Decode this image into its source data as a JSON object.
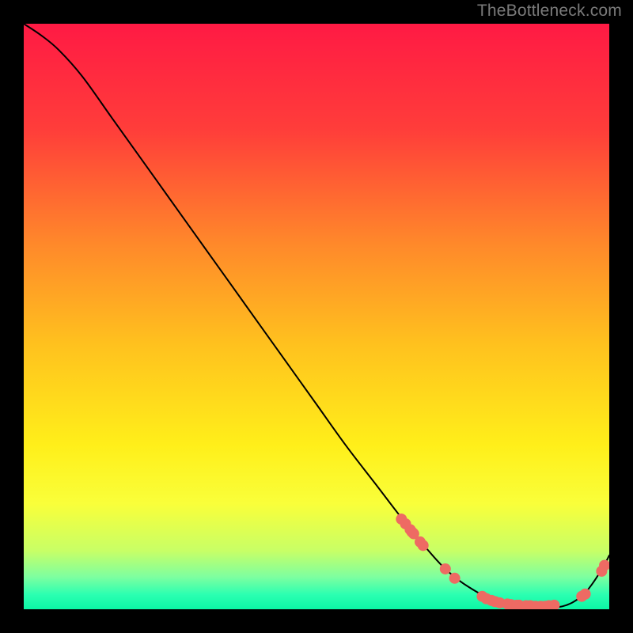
{
  "attribution": "TheBottleneck.com",
  "chart_data": {
    "type": "line",
    "title": "",
    "xlabel": "",
    "ylabel": "",
    "xlim": [
      0,
      100
    ],
    "ylim": [
      0,
      100
    ],
    "grid": false,
    "axes_visible": false,
    "background_gradient": {
      "stops": [
        {
          "offset": 0.0,
          "color": "#ff1a44"
        },
        {
          "offset": 0.18,
          "color": "#ff3d3a"
        },
        {
          "offset": 0.38,
          "color": "#ff8a2a"
        },
        {
          "offset": 0.55,
          "color": "#ffc21e"
        },
        {
          "offset": 0.72,
          "color": "#ffef1a"
        },
        {
          "offset": 0.82,
          "color": "#f9ff3a"
        },
        {
          "offset": 0.9,
          "color": "#c8ff66"
        },
        {
          "offset": 0.945,
          "color": "#7dffa0"
        },
        {
          "offset": 0.975,
          "color": "#2bffb1"
        },
        {
          "offset": 1.0,
          "color": "#0cf7a5"
        }
      ]
    },
    "series": [
      {
        "name": "bottleneck-curve",
        "color": "#000000",
        "width": 2,
        "x": [
          0,
          3,
          6,
          10,
          15,
          20,
          25,
          30,
          35,
          40,
          45,
          50,
          55,
          60,
          65,
          70,
          73,
          76,
          80,
          84,
          88,
          92,
          95,
          97,
          99,
          100
        ],
        "y": [
          100,
          98,
          95.5,
          91,
          84,
          77,
          70,
          63,
          56,
          49,
          42,
          35,
          28,
          21.5,
          15,
          9,
          6,
          3.8,
          1.6,
          0.5,
          0.3,
          0.5,
          2.0,
          4.2,
          7.3,
          9.2
        ]
      }
    ],
    "markers": {
      "name": "gpu-markers",
      "color": "#ee6a63",
      "radius": 7,
      "points": [
        {
          "x": 64.5,
          "y": 15.4
        },
        {
          "x": 65.2,
          "y": 14.6
        },
        {
          "x": 66.0,
          "y": 13.6
        },
        {
          "x": 66.3,
          "y": 13.2
        },
        {
          "x": 66.6,
          "y": 12.9
        },
        {
          "x": 67.7,
          "y": 11.5
        },
        {
          "x": 68.2,
          "y": 10.9
        },
        {
          "x": 72.0,
          "y": 6.9
        },
        {
          "x": 73.6,
          "y": 5.3
        },
        {
          "x": 78.3,
          "y": 2.2
        },
        {
          "x": 79.0,
          "y": 1.8
        },
        {
          "x": 79.9,
          "y": 1.5
        },
        {
          "x": 80.5,
          "y": 1.3
        },
        {
          "x": 81.3,
          "y": 1.1
        },
        {
          "x": 82.6,
          "y": 0.9
        },
        {
          "x": 83.2,
          "y": 0.8
        },
        {
          "x": 84.2,
          "y": 0.7
        },
        {
          "x": 84.6,
          "y": 0.7
        },
        {
          "x": 85.8,
          "y": 0.6
        },
        {
          "x": 86.5,
          "y": 0.6
        },
        {
          "x": 87.4,
          "y": 0.5
        },
        {
          "x": 88.3,
          "y": 0.5
        },
        {
          "x": 89.1,
          "y": 0.5
        },
        {
          "x": 89.7,
          "y": 0.6
        },
        {
          "x": 90.6,
          "y": 0.7
        },
        {
          "x": 95.3,
          "y": 2.2
        },
        {
          "x": 95.9,
          "y": 2.6
        },
        {
          "x": 98.7,
          "y": 6.5
        },
        {
          "x": 99.2,
          "y": 7.5
        }
      ]
    }
  }
}
